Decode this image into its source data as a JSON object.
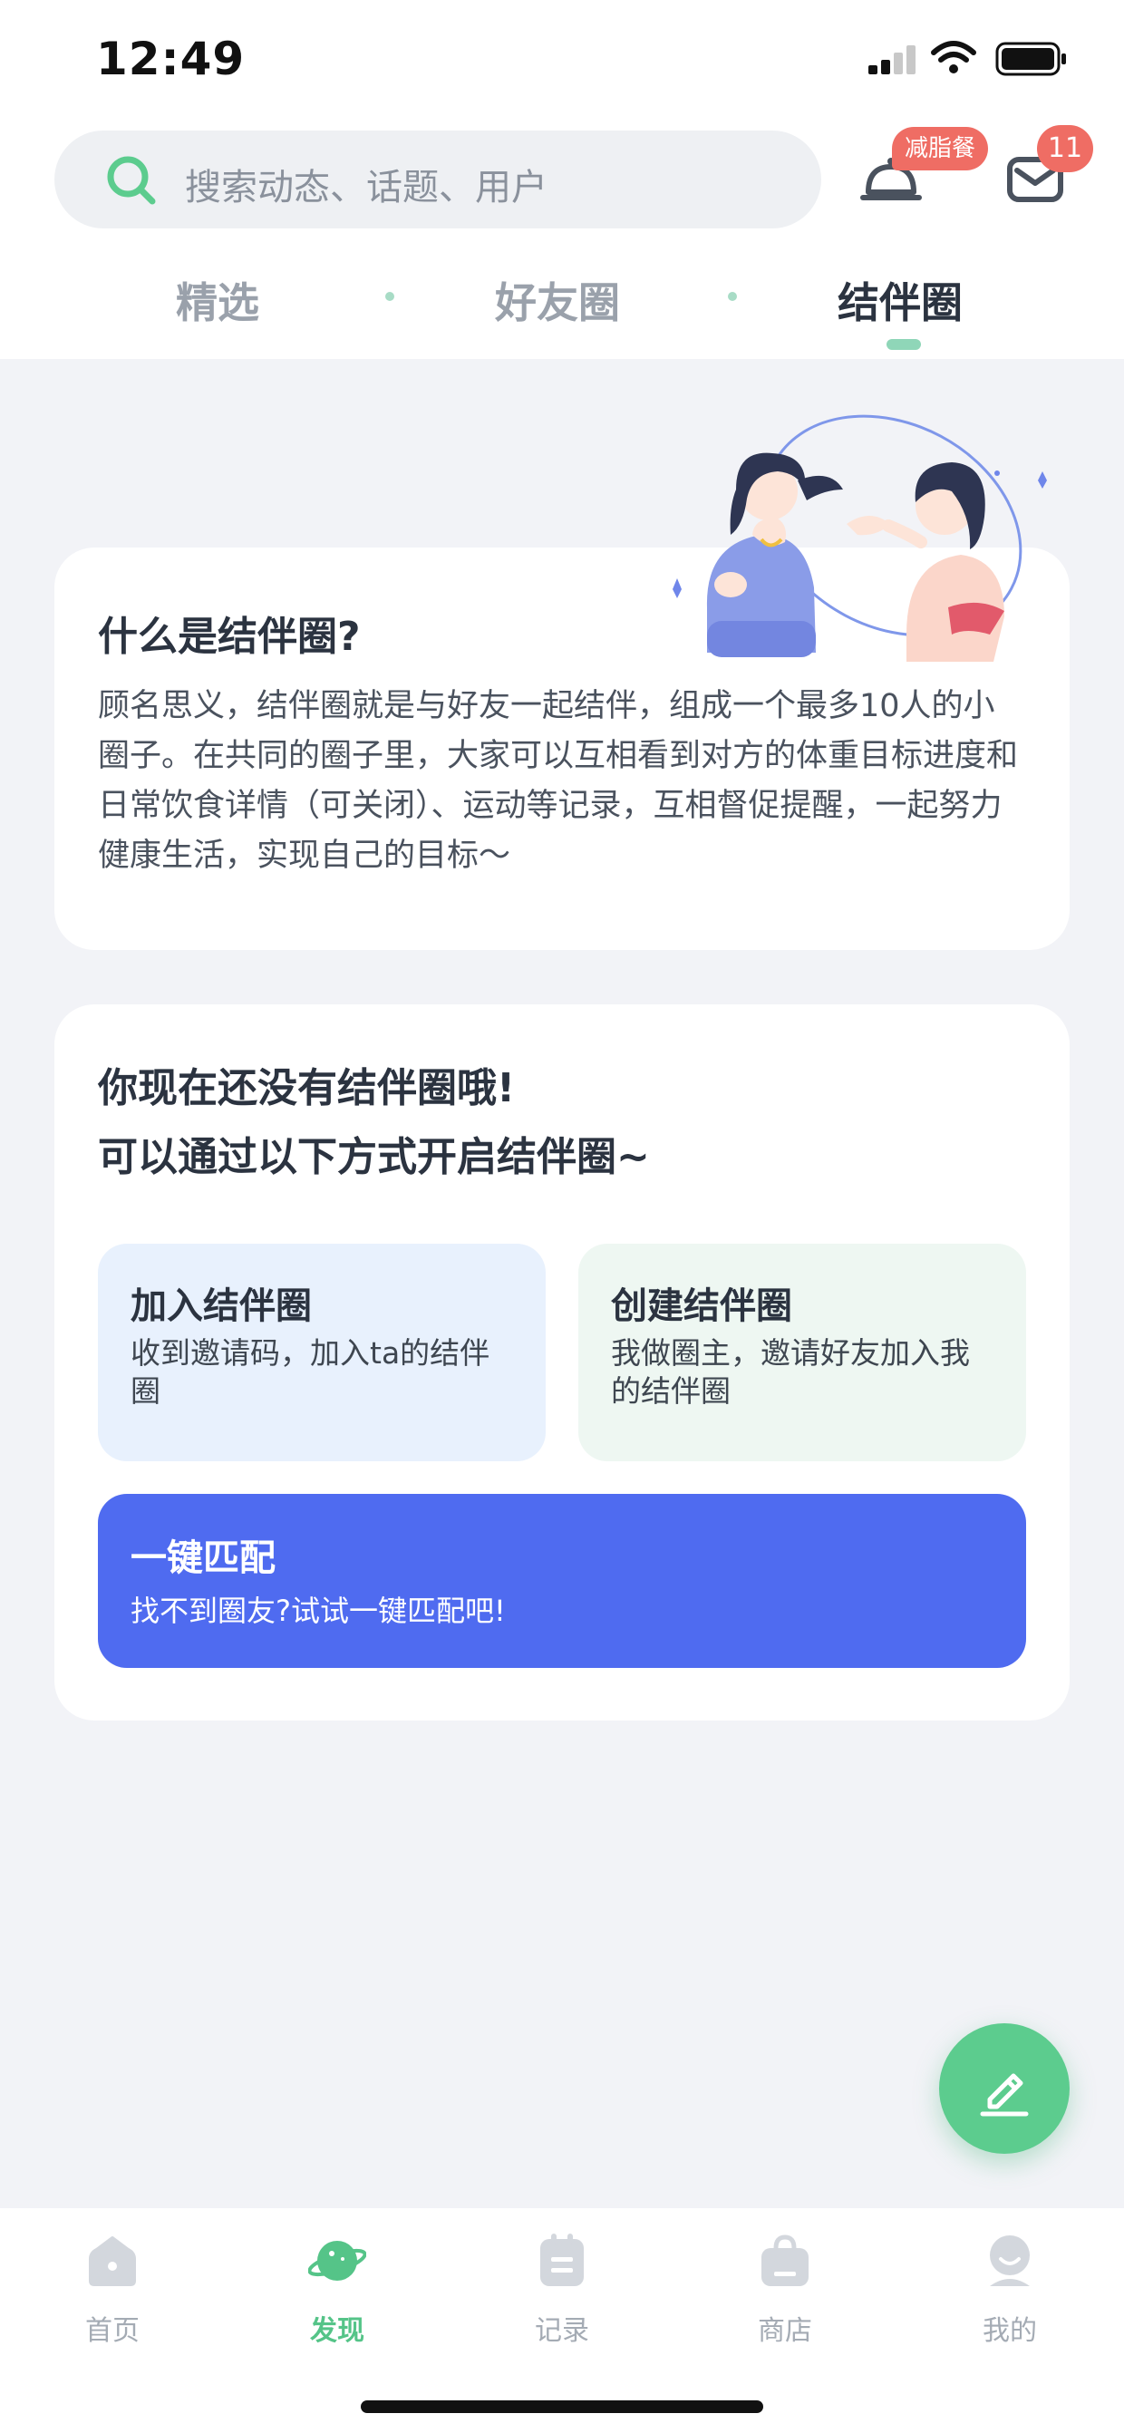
{
  "status_bar": {
    "time": "12:49"
  },
  "search": {
    "placeholder": "搜索动态、话题、用户"
  },
  "header": {
    "diet_badge": "减脂餐",
    "mail_count": "11"
  },
  "tabs": [
    {
      "label": "精选",
      "active": false
    },
    {
      "label": "好友圈",
      "active": false
    },
    {
      "label": "结伴圈",
      "active": true
    }
  ],
  "intro": {
    "title": "什么是结伴圈?",
    "description": "顾名思义，结伴圈就是与好友一起结伴，组成一个最多10人的小圈子。在共同的圈子里，大家可以互相看到对方的体重目标进度和日常饮食详情（可关闭）、运动等记录，互相督促提醒，一起努力健康生活，实现自己的目标～"
  },
  "empty_state": {
    "line1": "你现在还没有结伴圈哦!",
    "line2": "可以通过以下方式开启结伴圈~",
    "join": {
      "title": "加入结伴圈",
      "desc": "收到邀请码，加入ta的结伴圈"
    },
    "create": {
      "title": "创建结伴圈",
      "desc": "我做圈主，邀请好友加入我的结伴圈"
    },
    "match": {
      "title": "一键匹配",
      "desc": "找不到圈友?试试一键匹配吧!"
    }
  },
  "bottom_nav": [
    {
      "label": "首页",
      "icon": "home-icon",
      "active": false
    },
    {
      "label": "发现",
      "icon": "planet-icon",
      "active": true
    },
    {
      "label": "记录",
      "icon": "clipboard-icon",
      "active": false
    },
    {
      "label": "商店",
      "icon": "bag-icon",
      "active": false
    },
    {
      "label": "我的",
      "icon": "profile-icon",
      "active": false
    }
  ],
  "colors": {
    "accent": "#5ccc8e",
    "match_button": "#4f6bf0",
    "badge": "#ef6d64"
  }
}
